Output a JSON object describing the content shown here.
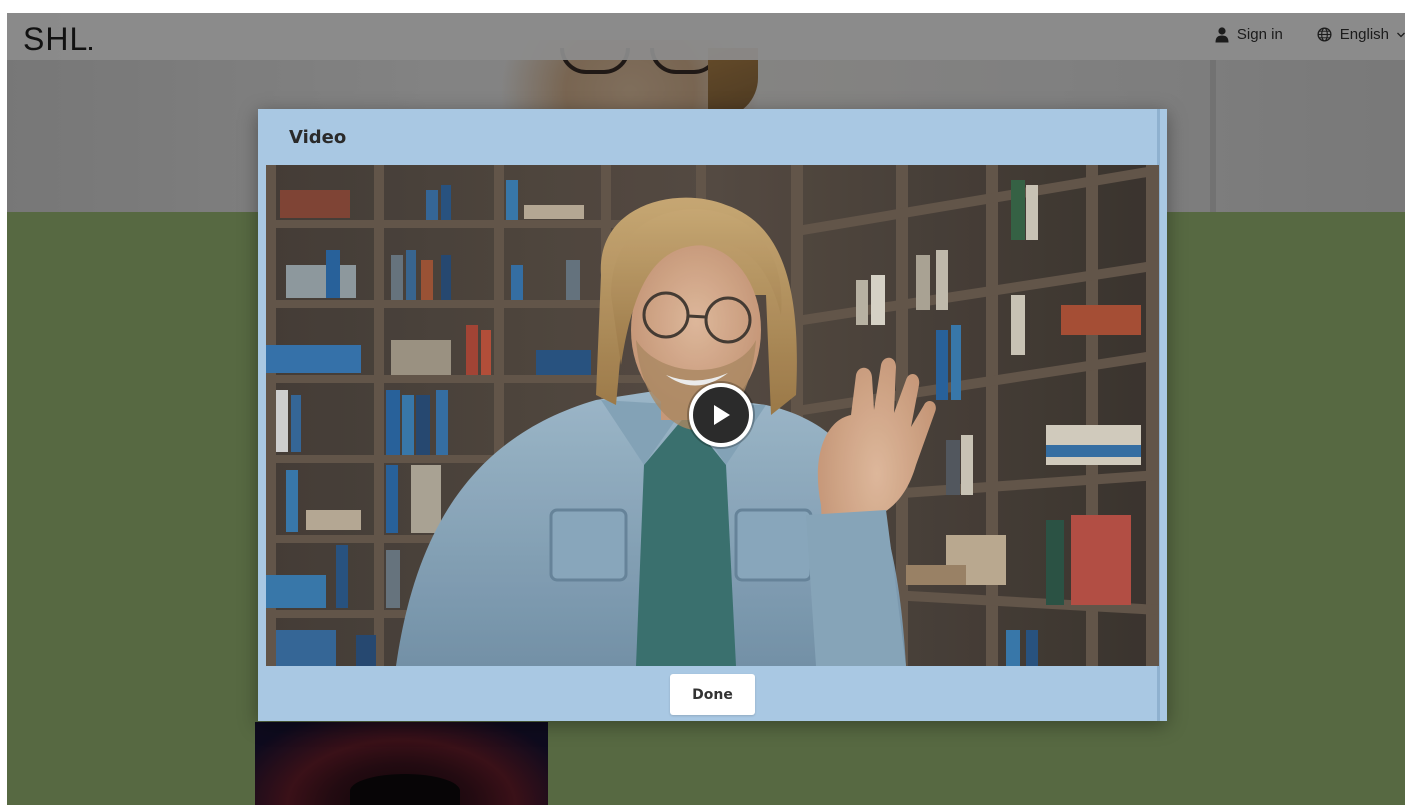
{
  "header": {
    "logo_text": "SHL",
    "sign_in_label": "Sign in",
    "language_label": "English"
  },
  "modal": {
    "title": "Video",
    "done_label": "Done",
    "video": {
      "thumbnail": "person-in-library-smiling",
      "play_icon": "play-icon"
    }
  },
  "colors": {
    "modal_background": "#a9c8e3",
    "page_green": "#9fbf78",
    "overlay": "rgba(0,0,0,0.45)"
  }
}
